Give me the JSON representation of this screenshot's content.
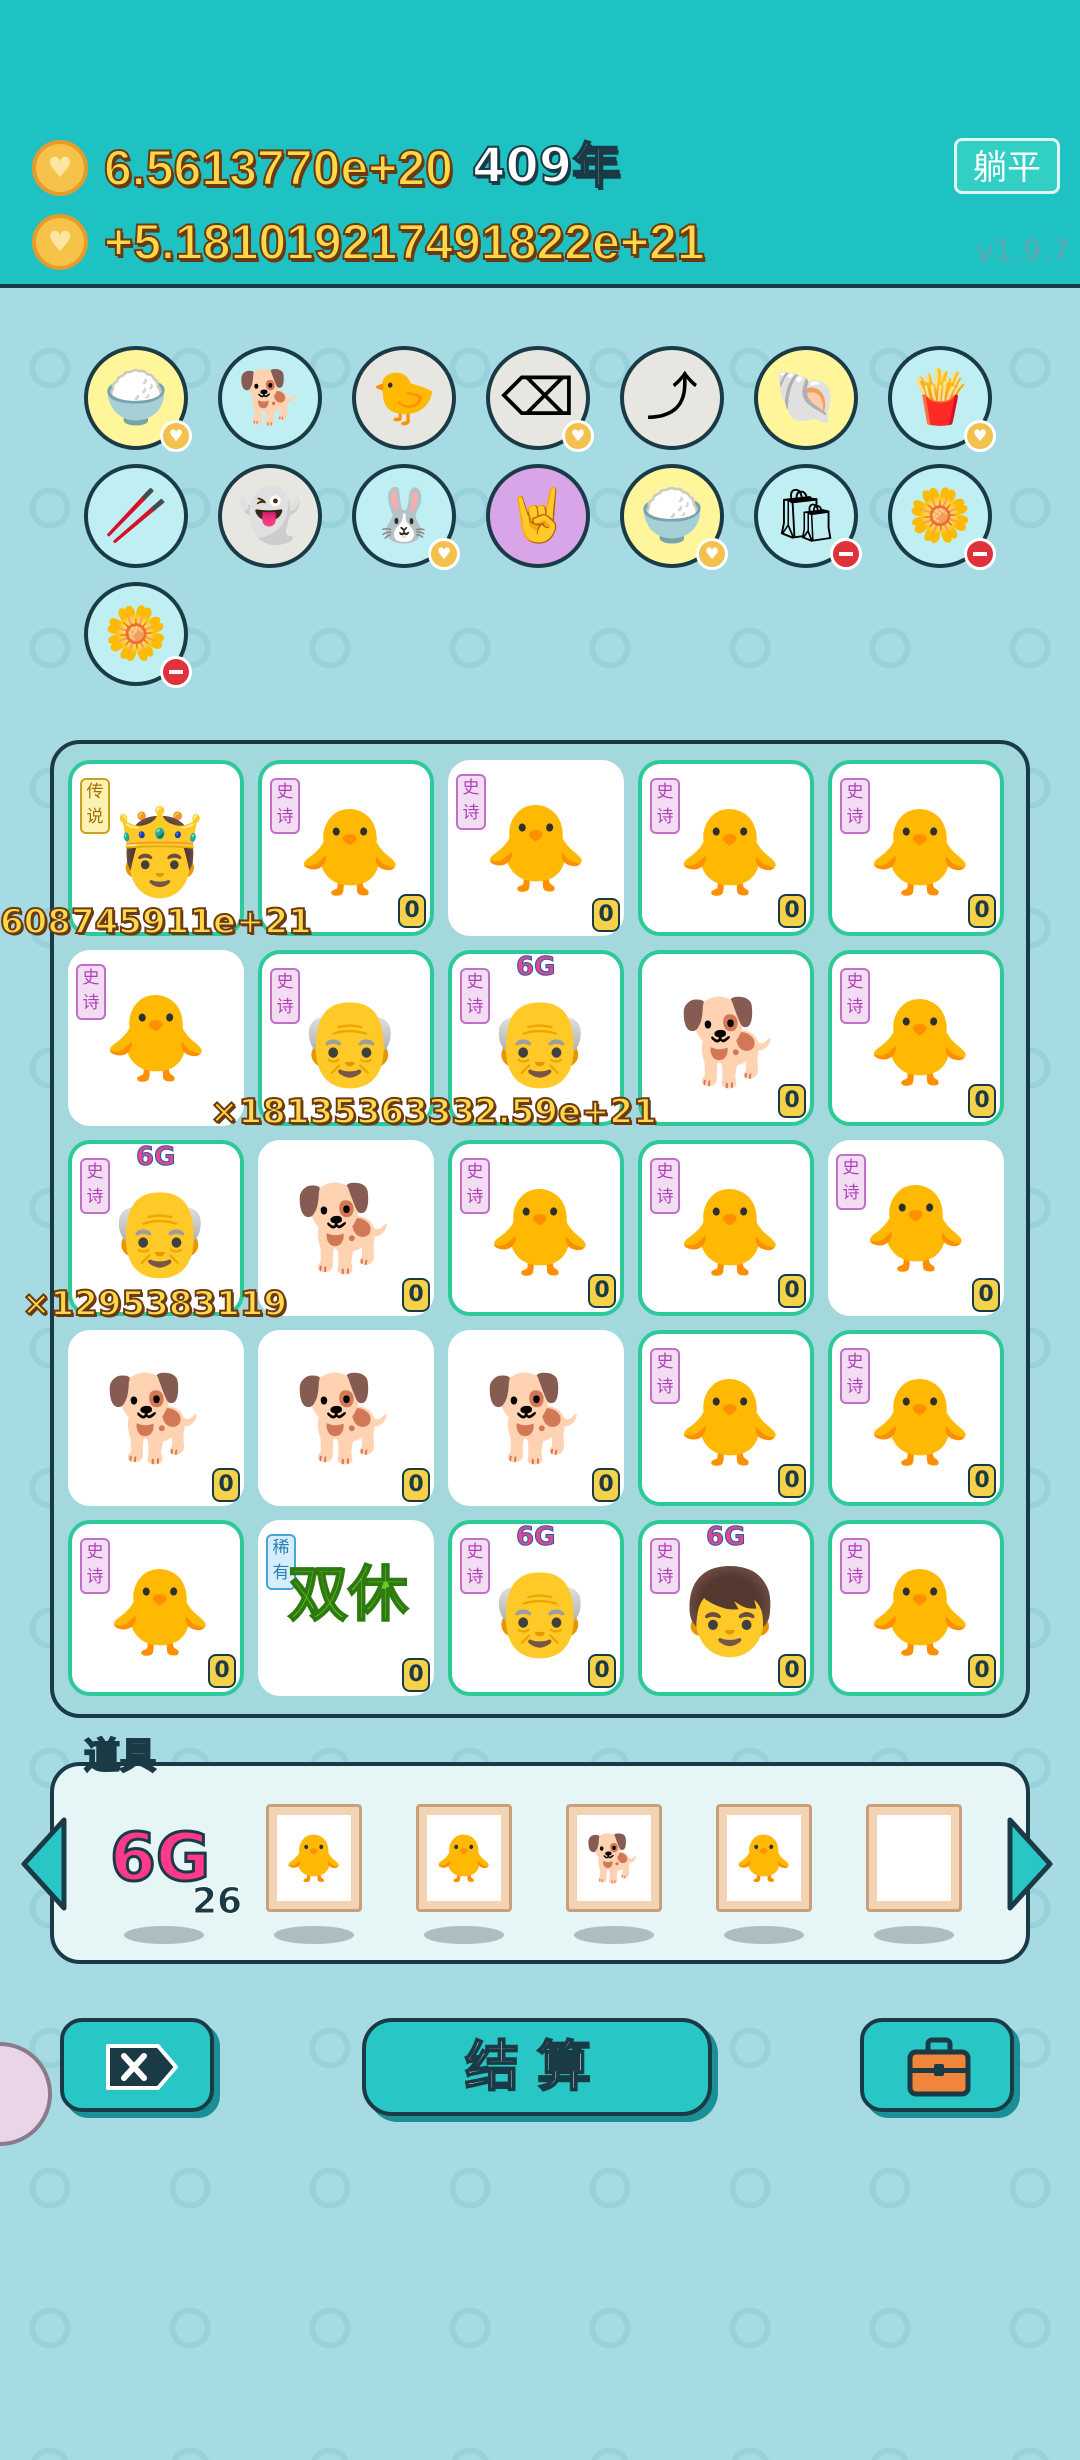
{
  "header": {
    "coins": "6.5613770e+20",
    "years": "409年",
    "income": "+5.181019217491822e+21",
    "lie_flat_button": "躺平",
    "version": "v1.9.7"
  },
  "items_panel": {
    "title": "道具",
    "g6_label": "6G",
    "g6_count": "26"
  },
  "board": {
    "tag_legend": "传说",
    "tag_epic": "史诗",
    "tag_rare": "稀有",
    "six_g": "6G",
    "zero": "0",
    "multiplier_1": "608745911e+21",
    "multiplier_2": "×1813536333",
    "multiplier_3": "2.59e+21",
    "multiplier_4": "×1295383119",
    "double_rest": "双休"
  },
  "actions": {
    "settle_label": "结算"
  },
  "colors": {
    "topbar": "#1ec2c2",
    "accent_gold": "#ffd84a",
    "outline": "#1a3b46",
    "board_bg": "#a3d9dd"
  }
}
